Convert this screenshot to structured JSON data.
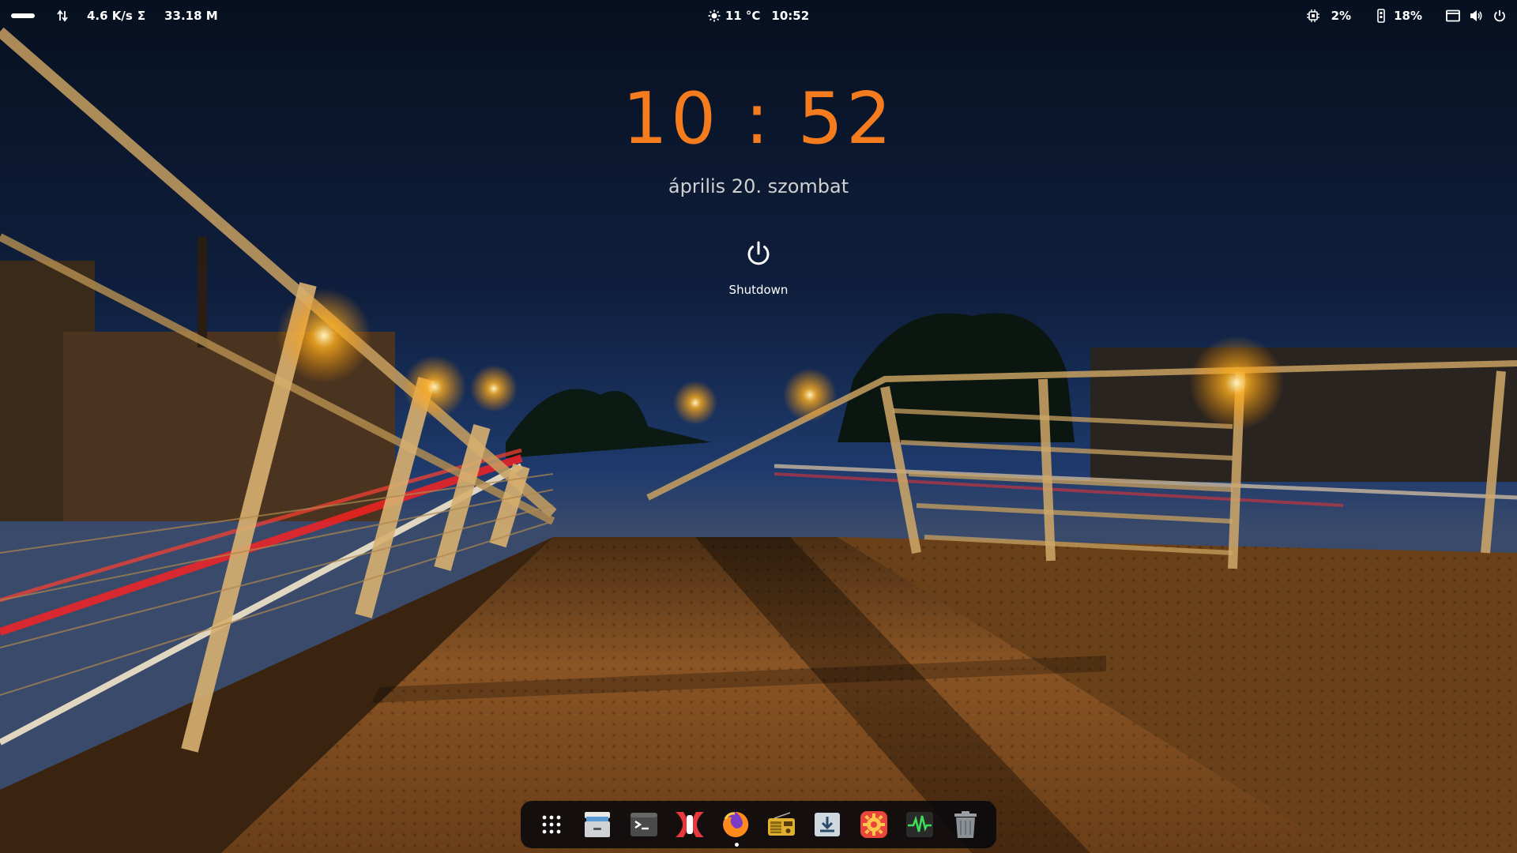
{
  "topbar": {
    "net_speed": "4.6 K/s",
    "sigma": "Σ",
    "total_traffic": "33.18 M",
    "weather_temp": "11 °C",
    "time": "10:52",
    "cpu_percent": "2%",
    "mem_percent": "18%",
    "icons": {
      "activities": "activities-pill",
      "network": "up-down-arrows-icon",
      "weather": "sun-icon",
      "cpu": "cpu-chip-icon",
      "memory": "memory-icon",
      "screen": "screen-icon",
      "volume": "volume-icon",
      "power": "power-icon"
    }
  },
  "lockscreen": {
    "clock": "10 : 52",
    "date": "április 20. szombat",
    "shutdown_label": "Shutdown",
    "clock_color": "#f57c1e"
  },
  "dock": {
    "items": [
      {
        "name": "app-grid",
        "icon": "app-grid-icon"
      },
      {
        "name": "files",
        "icon": "file-cabinet-icon"
      },
      {
        "name": "terminal",
        "icon": "terminal-icon"
      },
      {
        "name": "network-manager",
        "icon": "red-logo-icon"
      },
      {
        "name": "firefox",
        "icon": "firefox-icon",
        "running": true
      },
      {
        "name": "radio",
        "icon": "radio-icon"
      },
      {
        "name": "downloader",
        "icon": "download-icon"
      },
      {
        "name": "settings",
        "icon": "gear-icon"
      },
      {
        "name": "system-monitor",
        "icon": "activity-monitor-icon"
      },
      {
        "name": "trash",
        "icon": "trash-icon"
      }
    ]
  },
  "colors": {
    "sky_top": "#07101f",
    "sky_horizon": "#1f3a6b",
    "deck": "#7a4a1e",
    "lamp": "#ffb020"
  }
}
